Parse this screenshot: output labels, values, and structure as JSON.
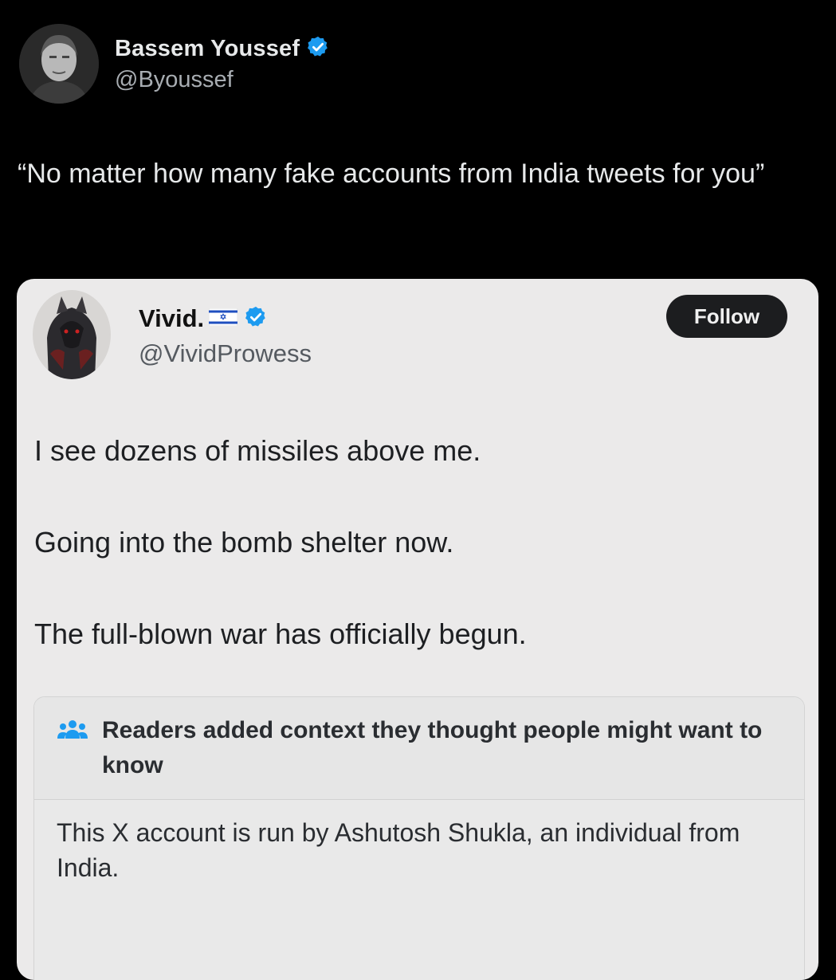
{
  "outer_tweet": {
    "name": "Bassem Youssef",
    "handle": "@Byoussef",
    "text": "“No matter how many fake accounts from India tweets for you”",
    "avatar_icon": "profile-photo",
    "verified_icon": "verified-badge-icon",
    "verified_color": "#1d9bf0"
  },
  "quoted_tweet": {
    "name": "Vivid.",
    "flag_icon": "israel-flag-icon",
    "handle": "@VividProwess",
    "follow_label": "Follow",
    "paragraphs": [
      "I see dozens of missiles above me.",
      "Going into the bomb shelter now.",
      "The full-blown war has officially begun."
    ],
    "community_note": {
      "icon": "people-icon",
      "icon_color": "#1d9bf0",
      "title": "Readers added context they thought people might want to know",
      "body": "This X account is run by Ashutosh Shukla, an individual from India."
    }
  }
}
